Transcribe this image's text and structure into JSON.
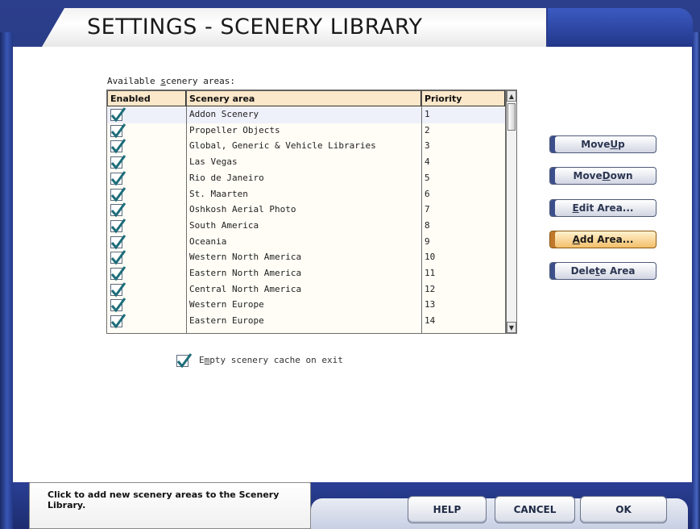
{
  "window": {
    "title": "SETTINGS - SCENERY LIBRARY"
  },
  "list": {
    "label_prefix": "Available ",
    "label_accel": "s",
    "label_suffix": "cenery areas:",
    "columns": [
      "Enabled",
      "Scenery area",
      "Priority"
    ],
    "rows": [
      {
        "enabled": true,
        "area": "Addon Scenery",
        "priority": "1"
      },
      {
        "enabled": true,
        "area": "Propeller Objects",
        "priority": "2"
      },
      {
        "enabled": true,
        "area": "Global, Generic & Vehicle Libraries",
        "priority": "3"
      },
      {
        "enabled": true,
        "area": "Las Vegas",
        "priority": "4"
      },
      {
        "enabled": true,
        "area": "Rio de Janeiro",
        "priority": "5"
      },
      {
        "enabled": true,
        "area": "St. Maarten",
        "priority": "6"
      },
      {
        "enabled": true,
        "area": "Oshkosh Aerial Photo",
        "priority": "7"
      },
      {
        "enabled": true,
        "area": "South America",
        "priority": "8"
      },
      {
        "enabled": true,
        "area": "Oceania",
        "priority": "9"
      },
      {
        "enabled": true,
        "area": "Western North America",
        "priority": "10"
      },
      {
        "enabled": true,
        "area": "Eastern North America",
        "priority": "11"
      },
      {
        "enabled": true,
        "area": "Central North America",
        "priority": "12"
      },
      {
        "enabled": true,
        "area": "Western Europe",
        "priority": "13"
      },
      {
        "enabled": true,
        "area": "Eastern Europe",
        "priority": "14"
      }
    ]
  },
  "side_buttons": {
    "move_up_a": "Move ",
    "move_up_b": "U",
    "move_up_c": "p",
    "move_down_a": "Move ",
    "move_down_b": "D",
    "move_down_c": "own",
    "edit_area_a": "",
    "edit_area_b": "E",
    "edit_area_c": "dit Area...",
    "add_area_a": "",
    "add_area_b": "A",
    "add_area_c": "dd Area...",
    "delete_area_a": "Dele",
    "delete_area_b": "t",
    "delete_area_c": "e Area"
  },
  "cache": {
    "label_a": "E",
    "label_b": "m",
    "label_c": "pty scenery cache on exit",
    "checked": true
  },
  "status": {
    "text": "Click to add new scenery areas to the Scenery Library."
  },
  "footer": {
    "help": "HELP",
    "cancel": "CANCEL",
    "ok": "OK"
  },
  "colors": {
    "frame_blue": "#22378a",
    "header_peach": "#fbe7c9",
    "active_button": "#f3bf6a",
    "check_teal": "#1d6e7a"
  }
}
